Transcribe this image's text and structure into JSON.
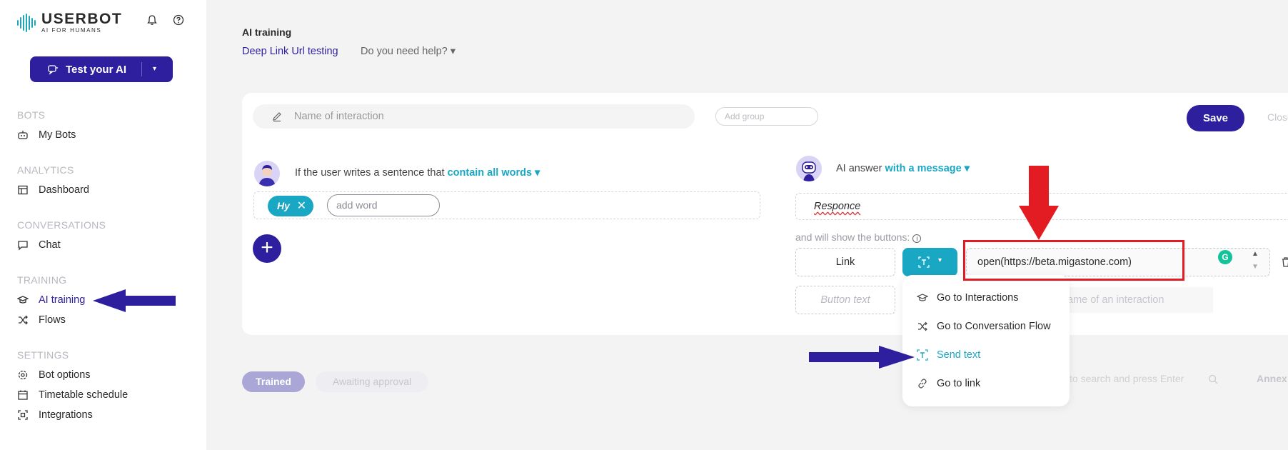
{
  "brand": {
    "name": "USERBOT",
    "tagline": "AI FOR HUMANS"
  },
  "header_icons": [
    "bell-icon",
    "help-icon"
  ],
  "test_button": {
    "label": "Test your AI",
    "caret": "▾"
  },
  "sidebar": {
    "sections": [
      {
        "title": "BOTS",
        "items": [
          {
            "label": "My Bots",
            "icon": "robot-icon"
          }
        ]
      },
      {
        "title": "ANALYTICS",
        "items": [
          {
            "label": "Dashboard",
            "icon": "dashboard-icon"
          }
        ]
      },
      {
        "title": "CONVERSATIONS",
        "items": [
          {
            "label": "Chat",
            "icon": "chat-icon"
          }
        ]
      },
      {
        "title": "TRAINING",
        "items": [
          {
            "label": "AI training",
            "icon": "graduation-cap-icon",
            "active": true
          },
          {
            "label": "Flows",
            "icon": "shuffle-icon"
          }
        ]
      },
      {
        "title": "SETTINGS",
        "items": [
          {
            "label": "Bot options",
            "icon": "gear-icon"
          },
          {
            "label": "Timetable schedule",
            "icon": "calendar-icon"
          },
          {
            "label": "Integrations",
            "icon": "integrations-icon"
          }
        ]
      }
    ]
  },
  "page": {
    "title": "AI training",
    "breadcrumb_link": "Deep Link Url testing",
    "help": "Do you need help? ▾"
  },
  "editor": {
    "name_placeholder": "Name of interaction",
    "add_group_placeholder": "Add group",
    "save_label": "Save",
    "close_label": "Close",
    "condition_prefix": "If the user writes a sentence that",
    "condition_link": "contain all words ▾",
    "word_chip": "Hy",
    "chip_close": "✕",
    "add_word_placeholder": "add word",
    "plus": "+",
    "ai_answer_prefix": "AI answer",
    "ai_answer_link": "with a message ▾",
    "response": "Responce",
    "buttons_label": "and will show the buttons:",
    "info": "i",
    "link_label": "Link",
    "type_caret": "▾",
    "url_value": "open(https://beta.migastone.com)",
    "grammarly_badge": "G",
    "spin_up": "▲",
    "spin_down": "▼",
    "button_text_placeholder": "Button text",
    "interaction_placeholder": "ame of an interaction"
  },
  "dropdown_menu": [
    {
      "label": "Go to Interactions",
      "icon": "graduation-cap-icon"
    },
    {
      "label": "Go to Conversation Flow",
      "icon": "shuffle-icon"
    },
    {
      "label": "Send text",
      "icon": "text-icon",
      "selected": true
    },
    {
      "label": "Go to link",
      "icon": "link-icon"
    }
  ],
  "filters": {
    "trained": "Trained",
    "awaiting": "Awaiting approval"
  },
  "search": {
    "placeholder": "to search and press Enter"
  },
  "annex_label": "Annex",
  "colors": {
    "primary": "#2d1f9e",
    "accent": "#19a7c4",
    "highlight_red": "#e31b23"
  }
}
